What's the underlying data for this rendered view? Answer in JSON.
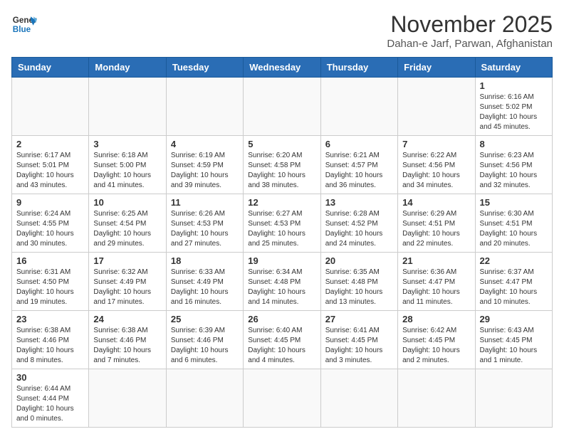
{
  "logo": {
    "text_general": "General",
    "text_blue": "Blue"
  },
  "title": {
    "month_year": "November 2025",
    "location": "Dahan-e Jarf, Parwan, Afghanistan"
  },
  "weekdays": [
    "Sunday",
    "Monday",
    "Tuesday",
    "Wednesday",
    "Thursday",
    "Friday",
    "Saturday"
  ],
  "weeks": [
    [
      {
        "day": "",
        "info": ""
      },
      {
        "day": "",
        "info": ""
      },
      {
        "day": "",
        "info": ""
      },
      {
        "day": "",
        "info": ""
      },
      {
        "day": "",
        "info": ""
      },
      {
        "day": "",
        "info": ""
      },
      {
        "day": "1",
        "info": "Sunrise: 6:16 AM\nSunset: 5:02 PM\nDaylight: 10 hours and 45 minutes."
      }
    ],
    [
      {
        "day": "2",
        "info": "Sunrise: 6:17 AM\nSunset: 5:01 PM\nDaylight: 10 hours and 43 minutes."
      },
      {
        "day": "3",
        "info": "Sunrise: 6:18 AM\nSunset: 5:00 PM\nDaylight: 10 hours and 41 minutes."
      },
      {
        "day": "4",
        "info": "Sunrise: 6:19 AM\nSunset: 4:59 PM\nDaylight: 10 hours and 39 minutes."
      },
      {
        "day": "5",
        "info": "Sunrise: 6:20 AM\nSunset: 4:58 PM\nDaylight: 10 hours and 38 minutes."
      },
      {
        "day": "6",
        "info": "Sunrise: 6:21 AM\nSunset: 4:57 PM\nDaylight: 10 hours and 36 minutes."
      },
      {
        "day": "7",
        "info": "Sunrise: 6:22 AM\nSunset: 4:56 PM\nDaylight: 10 hours and 34 minutes."
      },
      {
        "day": "8",
        "info": "Sunrise: 6:23 AM\nSunset: 4:56 PM\nDaylight: 10 hours and 32 minutes."
      }
    ],
    [
      {
        "day": "9",
        "info": "Sunrise: 6:24 AM\nSunset: 4:55 PM\nDaylight: 10 hours and 30 minutes."
      },
      {
        "day": "10",
        "info": "Sunrise: 6:25 AM\nSunset: 4:54 PM\nDaylight: 10 hours and 29 minutes."
      },
      {
        "day": "11",
        "info": "Sunrise: 6:26 AM\nSunset: 4:53 PM\nDaylight: 10 hours and 27 minutes."
      },
      {
        "day": "12",
        "info": "Sunrise: 6:27 AM\nSunset: 4:53 PM\nDaylight: 10 hours and 25 minutes."
      },
      {
        "day": "13",
        "info": "Sunrise: 6:28 AM\nSunset: 4:52 PM\nDaylight: 10 hours and 24 minutes."
      },
      {
        "day": "14",
        "info": "Sunrise: 6:29 AM\nSunset: 4:51 PM\nDaylight: 10 hours and 22 minutes."
      },
      {
        "day": "15",
        "info": "Sunrise: 6:30 AM\nSunset: 4:51 PM\nDaylight: 10 hours and 20 minutes."
      }
    ],
    [
      {
        "day": "16",
        "info": "Sunrise: 6:31 AM\nSunset: 4:50 PM\nDaylight: 10 hours and 19 minutes."
      },
      {
        "day": "17",
        "info": "Sunrise: 6:32 AM\nSunset: 4:49 PM\nDaylight: 10 hours and 17 minutes."
      },
      {
        "day": "18",
        "info": "Sunrise: 6:33 AM\nSunset: 4:49 PM\nDaylight: 10 hours and 16 minutes."
      },
      {
        "day": "19",
        "info": "Sunrise: 6:34 AM\nSunset: 4:48 PM\nDaylight: 10 hours and 14 minutes."
      },
      {
        "day": "20",
        "info": "Sunrise: 6:35 AM\nSunset: 4:48 PM\nDaylight: 10 hours and 13 minutes."
      },
      {
        "day": "21",
        "info": "Sunrise: 6:36 AM\nSunset: 4:47 PM\nDaylight: 10 hours and 11 minutes."
      },
      {
        "day": "22",
        "info": "Sunrise: 6:37 AM\nSunset: 4:47 PM\nDaylight: 10 hours and 10 minutes."
      }
    ],
    [
      {
        "day": "23",
        "info": "Sunrise: 6:38 AM\nSunset: 4:46 PM\nDaylight: 10 hours and 8 minutes."
      },
      {
        "day": "24",
        "info": "Sunrise: 6:38 AM\nSunset: 4:46 PM\nDaylight: 10 hours and 7 minutes."
      },
      {
        "day": "25",
        "info": "Sunrise: 6:39 AM\nSunset: 4:46 PM\nDaylight: 10 hours and 6 minutes."
      },
      {
        "day": "26",
        "info": "Sunrise: 6:40 AM\nSunset: 4:45 PM\nDaylight: 10 hours and 4 minutes."
      },
      {
        "day": "27",
        "info": "Sunrise: 6:41 AM\nSunset: 4:45 PM\nDaylight: 10 hours and 3 minutes."
      },
      {
        "day": "28",
        "info": "Sunrise: 6:42 AM\nSunset: 4:45 PM\nDaylight: 10 hours and 2 minutes."
      },
      {
        "day": "29",
        "info": "Sunrise: 6:43 AM\nSunset: 4:45 PM\nDaylight: 10 hours and 1 minute."
      }
    ],
    [
      {
        "day": "30",
        "info": "Sunrise: 6:44 AM\nSunset: 4:44 PM\nDaylight: 10 hours and 0 minutes."
      },
      {
        "day": "",
        "info": ""
      },
      {
        "day": "",
        "info": ""
      },
      {
        "day": "",
        "info": ""
      },
      {
        "day": "",
        "info": ""
      },
      {
        "day": "",
        "info": ""
      },
      {
        "day": "",
        "info": ""
      }
    ]
  ]
}
